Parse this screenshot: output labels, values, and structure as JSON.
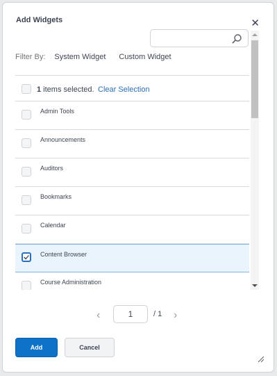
{
  "dialog": {
    "title": "Add Widgets",
    "close_icon": "close-icon"
  },
  "search": {
    "value": "",
    "icon": "search-icon"
  },
  "filter": {
    "label": "Filter By:",
    "options": [
      "System Widget",
      "Custom Widget"
    ]
  },
  "selection": {
    "count": "1",
    "text": " items selected.",
    "clear_label": "Clear Selection"
  },
  "widgets": [
    {
      "label": "Admin Tools",
      "checked": false
    },
    {
      "label": "Announcements",
      "checked": false
    },
    {
      "label": "Auditors",
      "checked": false
    },
    {
      "label": "Bookmarks",
      "checked": false
    },
    {
      "label": "Calendar",
      "checked": false
    },
    {
      "label": "Content Browser",
      "checked": true
    },
    {
      "label": "Course Administration",
      "checked": false
    }
  ],
  "pagination": {
    "current": "1",
    "total": "/ 1"
  },
  "buttons": {
    "add": "Add",
    "cancel": "Cancel"
  },
  "colors": {
    "accent": "#0c73c9",
    "selected_bg": "#eaf4fc",
    "link": "#2a70b8"
  }
}
